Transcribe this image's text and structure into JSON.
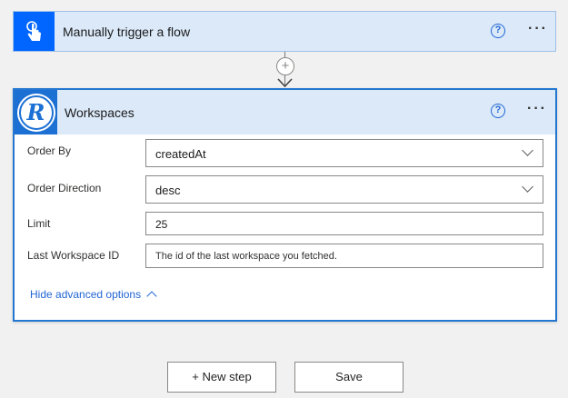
{
  "trigger": {
    "title": "Manually trigger a flow",
    "icon": "touch-hand-icon",
    "help": "?",
    "more": "···"
  },
  "connector": {
    "add_symbol": "+"
  },
  "action": {
    "title": "Workspaces",
    "logo_letter": "R",
    "help": "?",
    "more": "···",
    "fields": [
      {
        "label": "Order By",
        "value": "createdAt",
        "type": "dropdown"
      },
      {
        "label": "Order Direction",
        "value": "desc",
        "type": "dropdown"
      },
      {
        "label": "Limit",
        "value": "25",
        "type": "text"
      },
      {
        "label": "Last Workspace ID",
        "placeholder": "The id of the last workspace you fetched.",
        "type": "text"
      }
    ],
    "advanced_label": "Hide advanced options"
  },
  "footer": {
    "new_step_label": "+ New step",
    "save_label": "Save"
  },
  "colors": {
    "accent": "#2266d4",
    "trigger_icon_bg": "#0066ff",
    "header_bg": "#dbe9f9"
  }
}
